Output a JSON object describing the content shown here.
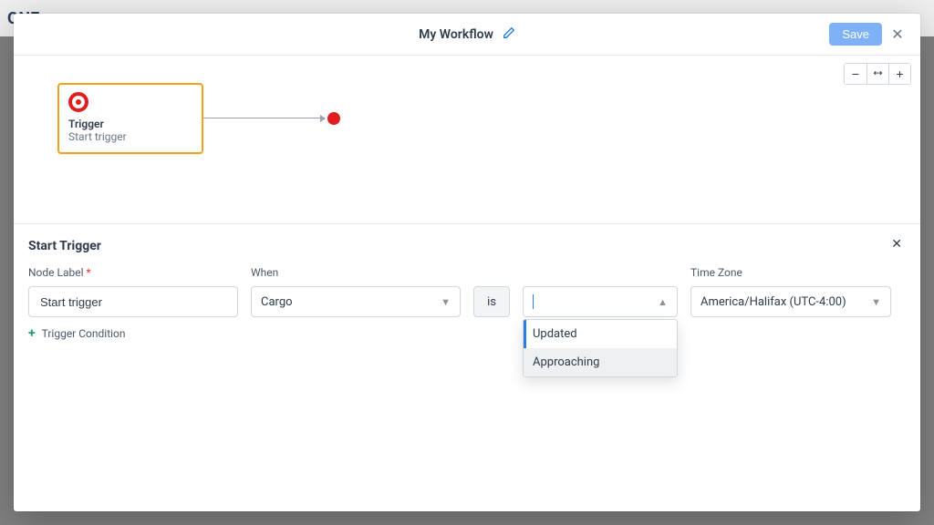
{
  "backdrop": {
    "brand_partial": "ONE"
  },
  "header": {
    "title": "My Workflow",
    "save_label": "Save"
  },
  "canvas": {
    "node": {
      "title": "Trigger",
      "subtitle": "Start trigger"
    }
  },
  "panel": {
    "title": "Start Trigger",
    "node_label_label": "Node Label",
    "node_label_value": "Start trigger",
    "when_label": "When",
    "when_value": "Cargo",
    "operator": "is",
    "timezone_label": "Time Zone",
    "timezone_value": "America/Halifax (UTC-4:00)",
    "dropdown": {
      "option1": "Updated",
      "option2": "Approaching"
    },
    "add_condition_label": "Trigger Condition"
  }
}
